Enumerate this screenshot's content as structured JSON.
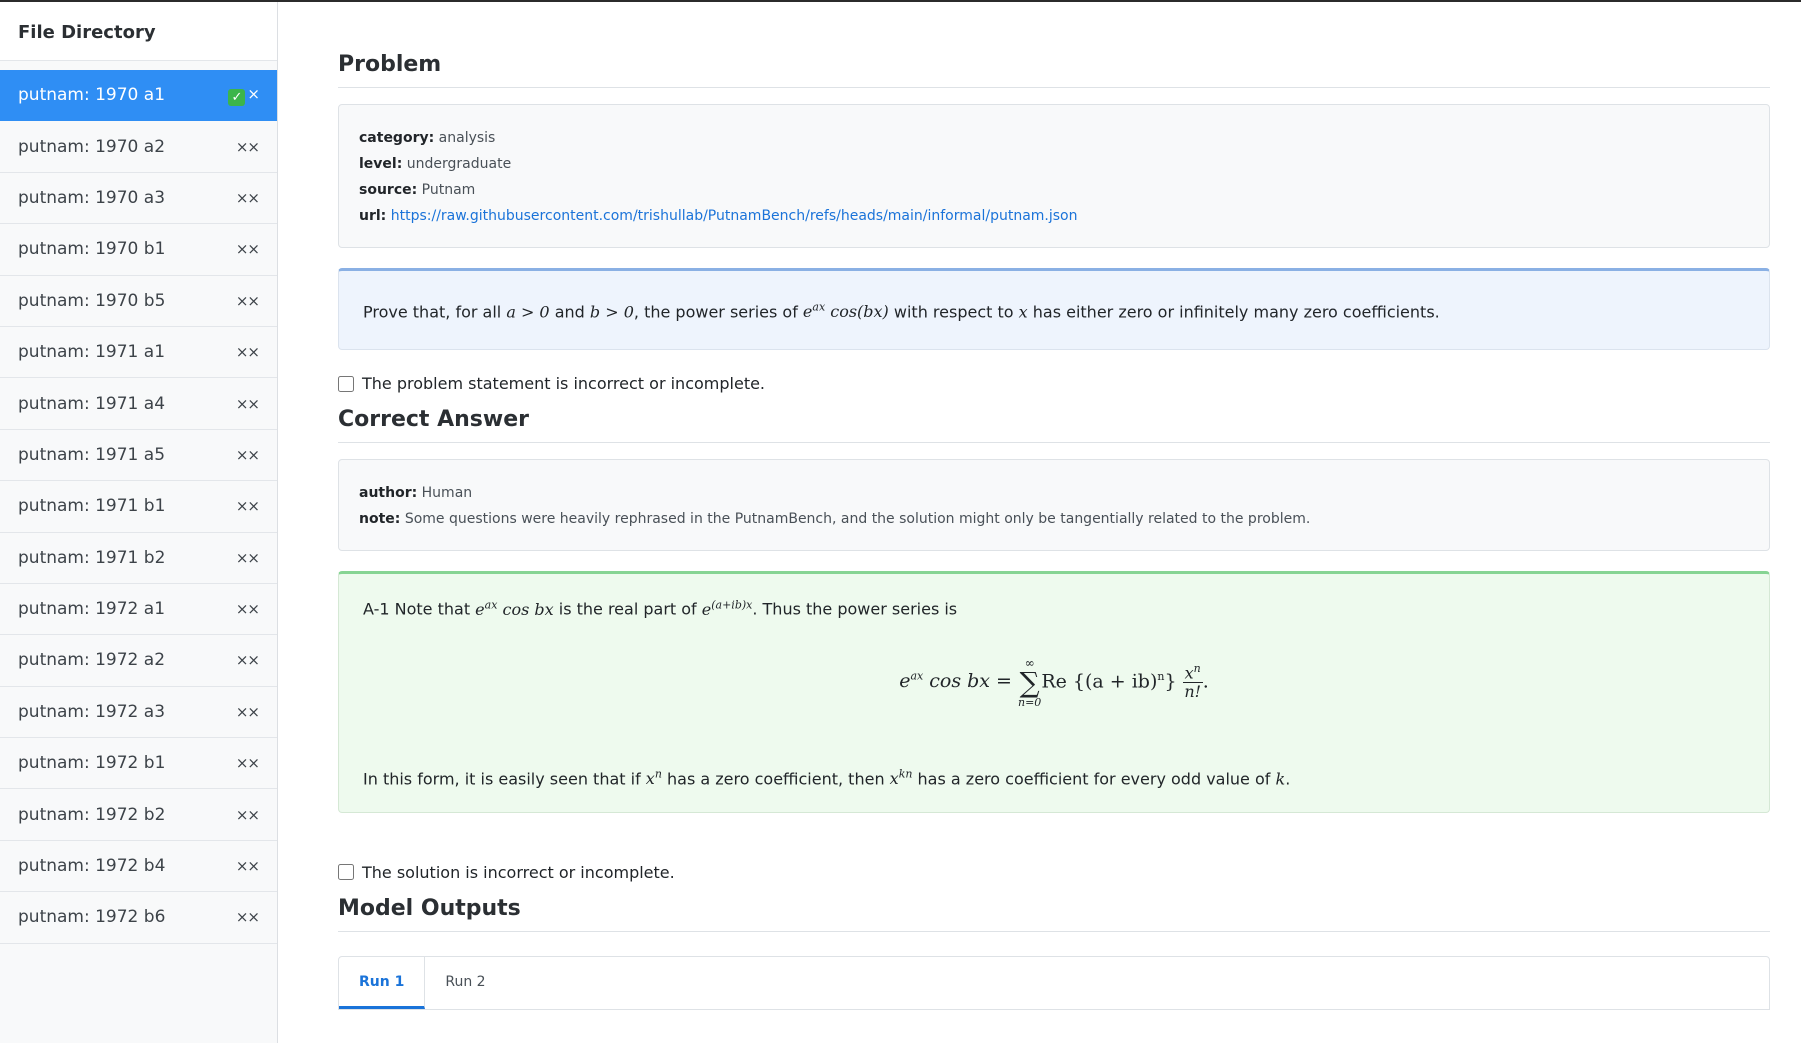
{
  "sidebar": {
    "title": "File Directory",
    "items": [
      {
        "label": "putnam: 1970 a1",
        "status": "✅×",
        "active": true
      },
      {
        "label": "putnam: 1970 a2",
        "status": "××",
        "active": false
      },
      {
        "label": "putnam: 1970 a3",
        "status": "××",
        "active": false
      },
      {
        "label": "putnam: 1970 b1",
        "status": "××",
        "active": false
      },
      {
        "label": "putnam: 1970 b5",
        "status": "××",
        "active": false
      },
      {
        "label": "putnam: 1971 a1",
        "status": "××",
        "active": false
      },
      {
        "label": "putnam: 1971 a4",
        "status": "××",
        "active": false
      },
      {
        "label": "putnam: 1971 a5",
        "status": "××",
        "active": false
      },
      {
        "label": "putnam: 1971 b1",
        "status": "××",
        "active": false
      },
      {
        "label": "putnam: 1971 b2",
        "status": "××",
        "active": false
      },
      {
        "label": "putnam: 1972 a1",
        "status": "××",
        "active": false
      },
      {
        "label": "putnam: 1972 a2",
        "status": "××",
        "active": false
      },
      {
        "label": "putnam: 1972 a3",
        "status": "××",
        "active": false
      },
      {
        "label": "putnam: 1972 b1",
        "status": "××",
        "active": false
      },
      {
        "label": "putnam: 1972 b2",
        "status": "××",
        "active": false
      },
      {
        "label": "putnam: 1972 b4",
        "status": "××",
        "active": false
      },
      {
        "label": "putnam: 1972 b6",
        "status": "××",
        "active": false
      }
    ]
  },
  "problem": {
    "heading": "Problem",
    "meta": {
      "category_key": "category:",
      "category": "analysis",
      "level_key": "level:",
      "level": "undergraduate",
      "source_key": "source:",
      "source": "Putnam",
      "url_key": "url:",
      "url": "https://raw.githubusercontent.com/trishullab/PutnamBench/refs/heads/main/informal/putnam.json"
    },
    "statement": {
      "t1": "Prove that, for all ",
      "m1": "a > 0",
      "t2": " and ",
      "m2": "b > 0",
      "t3": ", the power series of ",
      "m3_base": "e",
      "m3_sup": "ax",
      "m3_rest": " cos(bx)",
      "t4": " with respect to ",
      "m4": "x",
      "t5": " has either zero or infinitely many zero coefficients."
    },
    "incorrect_checkbox_label": "The problem statement is incorrect or incomplete."
  },
  "answer": {
    "heading": "Correct Answer",
    "meta": {
      "author_key": "author:",
      "author": "Human",
      "note_key": "note:",
      "note": "Some questions were heavily rephrased in the PutnamBench, and the solution might only be tangentially related to the problem."
    },
    "solution": {
      "l1_a": "A-1 Note that ",
      "l1_m1_base": "e",
      "l1_m1_sup": "ax",
      "l1_m1_rest": " cos bx",
      "l1_b": " is the real part of ",
      "l1_m2_base": "e",
      "l1_m2_sup": "(a+ib)x",
      "l1_c": ". Thus the power series is",
      "eq_lhs_base": "e",
      "eq_lhs_sup": "ax",
      "eq_lhs_rest": " cos bx = ",
      "eq_sum_top": "∞",
      "eq_sum": "∑",
      "eq_sum_bottom": "n=0",
      "eq_body": "Re {(a + ib)",
      "eq_body_sup": "n",
      "eq_body_close": "}",
      "eq_frac_num": "x",
      "eq_frac_num_sup": "n",
      "eq_frac_den": "n!",
      "eq_end": ".",
      "l2_a": "In this form, it is easily seen that if ",
      "l2_m1_base": "x",
      "l2_m1_sup": "n",
      "l2_b": " has a zero coefficient, then ",
      "l2_m2_base": "x",
      "l2_m2_sup": "kn",
      "l2_c": " has a zero coefficient for every odd value of ",
      "l2_m3": "k",
      "l2_d": "."
    },
    "incorrect_checkbox_label": "The solution is incorrect or incomplete."
  },
  "model_outputs": {
    "heading": "Model Outputs",
    "tabs": [
      "Run 1",
      "Run 2"
    ]
  },
  "colors": {
    "accent": "#2f8ef4",
    "link": "#1a73d9",
    "statement_bg": "#eef4fd",
    "solution_bg": "#eefaee"
  }
}
